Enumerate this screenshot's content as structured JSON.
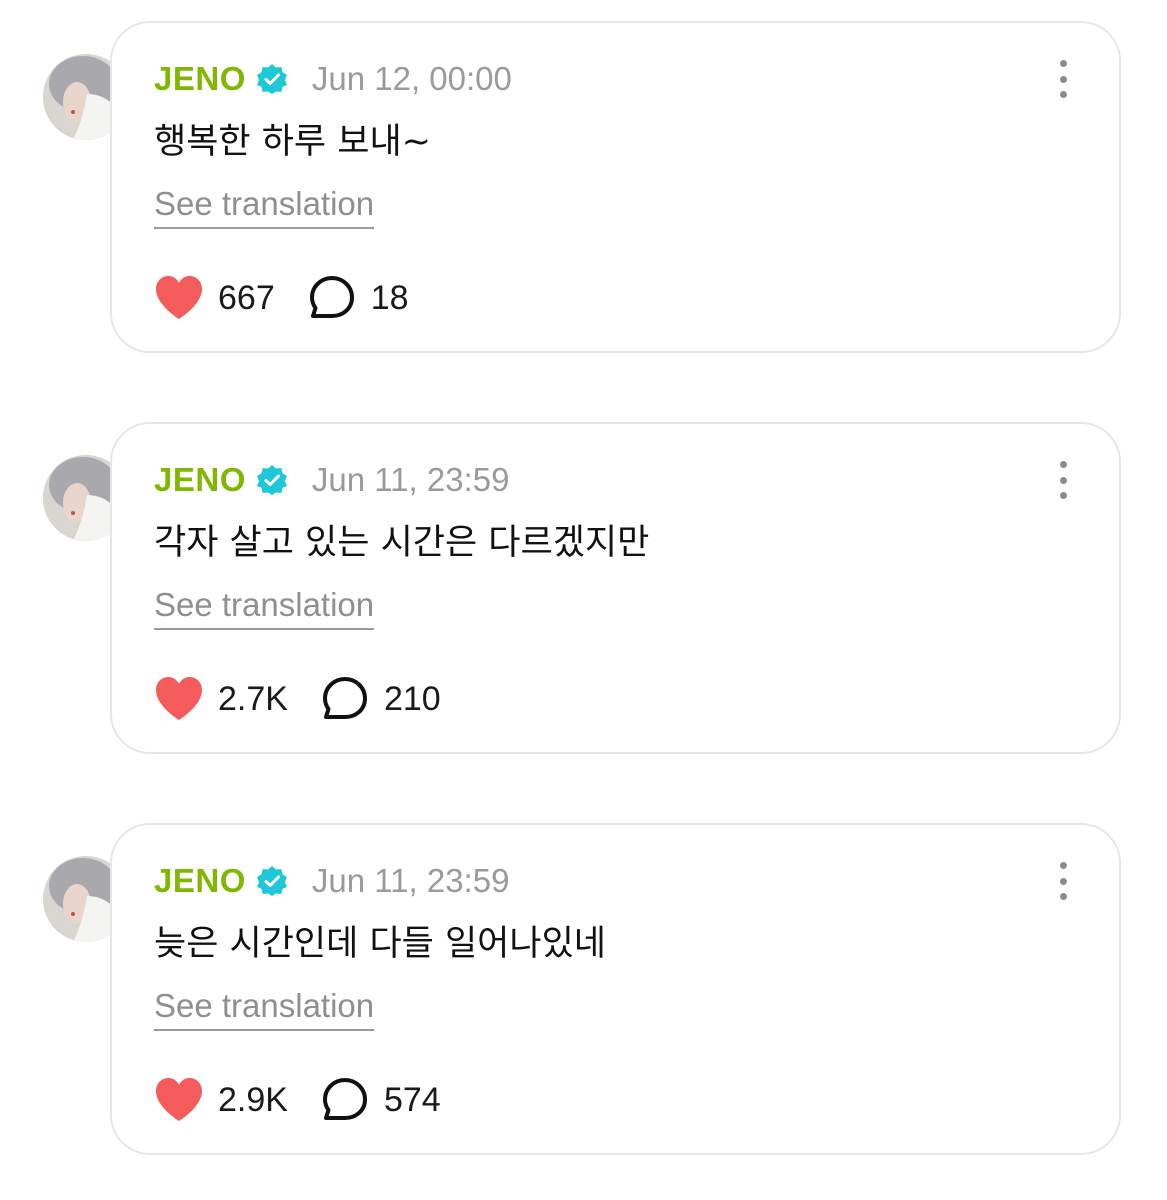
{
  "posts": [
    {
      "author": "JENO",
      "timestamp": "Jun 12, 00:00",
      "text": "행복한 하루 보내~",
      "translate_label": "See translation",
      "likes": "667",
      "comments": "18"
    },
    {
      "author": "JENO",
      "timestamp": "Jun 11, 23:59",
      "text": "각자 살고 있는 시간은 다르겠지만",
      "translate_label": "See translation",
      "likes": "2.7K",
      "comments": "210"
    },
    {
      "author": "JENO",
      "timestamp": "Jun 11, 23:59",
      "text": "늦은 시간인데 다들 일어나있네",
      "translate_label": "See translation",
      "likes": "2.9K",
      "comments": "574"
    }
  ],
  "icons": {
    "verified": "verified-badge-icon",
    "more": "more-vertical-icon",
    "like": "heart-icon",
    "comment": "comment-bubble-icon"
  },
  "colors": {
    "author": "#7fb800",
    "verified": "#1ec8d8",
    "heart": "#f45b5b",
    "timestamp": "#9a9a9a",
    "card_border": "#e6e6e6"
  }
}
